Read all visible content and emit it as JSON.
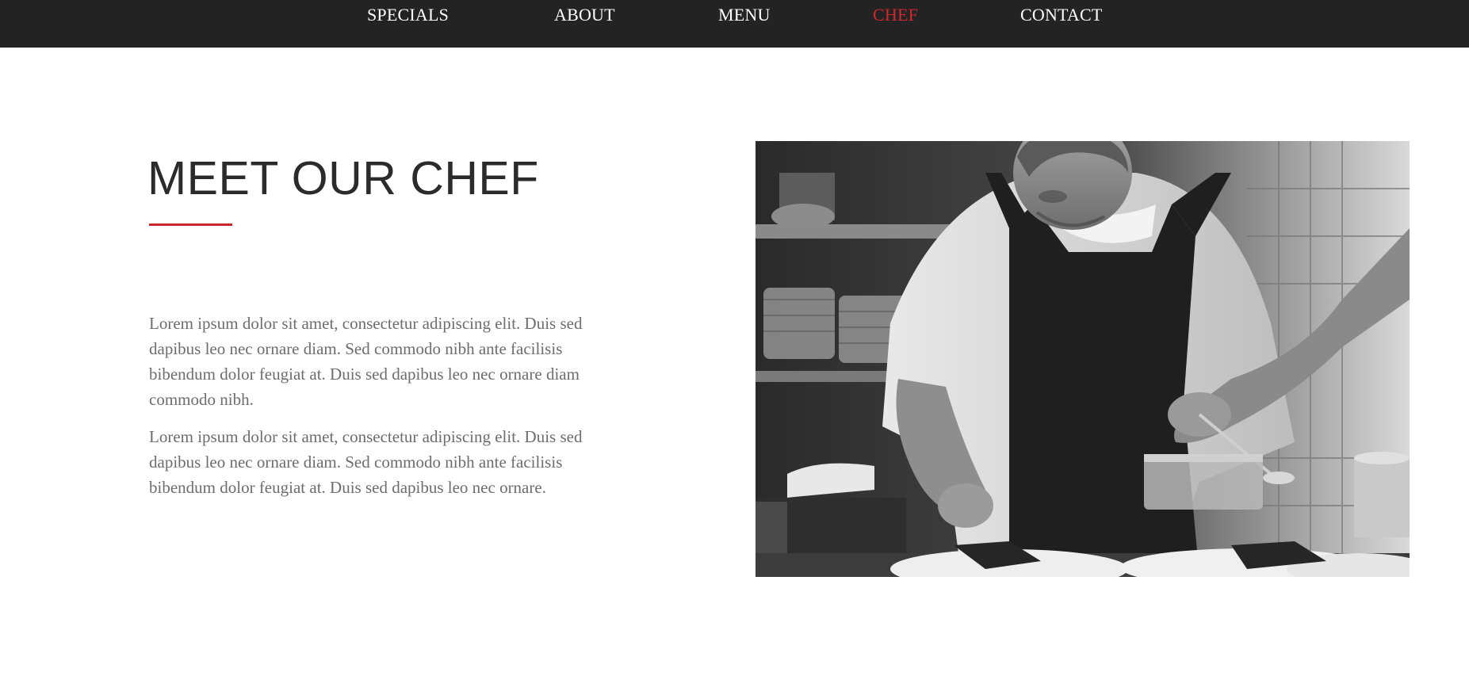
{
  "nav": {
    "items": [
      {
        "label": "SPECIALS",
        "active": false
      },
      {
        "label": "ABOUT",
        "active": false
      },
      {
        "label": "MENU",
        "active": false
      },
      {
        "label": "CHEF",
        "active": true
      },
      {
        "label": "CONTACT",
        "active": false
      }
    ],
    "active_color": "#d0282d",
    "background_color": "#232323"
  },
  "chef_section": {
    "title": "MEET OUR CHEF",
    "accent_color": "#c8262b",
    "paragraphs": [
      "Lorem ipsum dolor sit amet, consectetur adipiscing elit. Duis sed dapibus leo nec ornare diam. Sed commodo nibh ante facilisis bibendum dolor feugiat at. Duis sed dapibus leo nec ornare diam commodo nibh.",
      "Lorem ipsum dolor sit amet, consectetur adipiscing elit. Duis sed dapibus leo nec ornare diam. Sed commodo nibh ante facilisis bibendum dolor feugiat at. Duis sed dapibus leo nec ornare."
    ],
    "photo_icon": "chef-photo"
  }
}
